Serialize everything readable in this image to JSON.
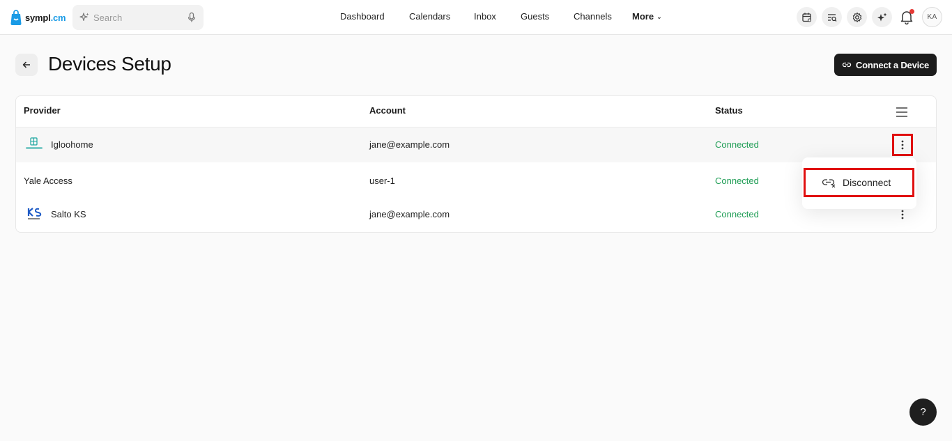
{
  "app": {
    "logo_text_main": "sympl",
    "logo_text_accent": ".cm"
  },
  "search": {
    "placeholder": "Search"
  },
  "nav": {
    "items": [
      "Dashboard",
      "Calendars",
      "Inbox",
      "Guests",
      "Channels"
    ],
    "more_label": "More"
  },
  "user": {
    "initials": "KA"
  },
  "page": {
    "title": "Devices Setup",
    "connect_button": "Connect a Device"
  },
  "table": {
    "columns": [
      "Provider",
      "Account",
      "Status"
    ],
    "rows": [
      {
        "provider": "Igloohome",
        "account": "jane@example.com",
        "status": "Connected",
        "logo": "igloohome-logo"
      },
      {
        "provider": "Yale Access",
        "account": "user-1",
        "status": "Connected",
        "logo": null
      },
      {
        "provider": "Salto KS",
        "account": "jane@example.com",
        "status": "Connected",
        "logo": "salto-ks-logo"
      }
    ]
  },
  "menu": {
    "disconnect_label": "Disconnect"
  },
  "help": {
    "label": "?"
  },
  "colors": {
    "status_connected": "#1f9d55",
    "highlight_border": "#e01010",
    "brand_blue": "#1a9be6",
    "dark_button": "#1c1c1c",
    "notification_dot": "#e53935"
  }
}
